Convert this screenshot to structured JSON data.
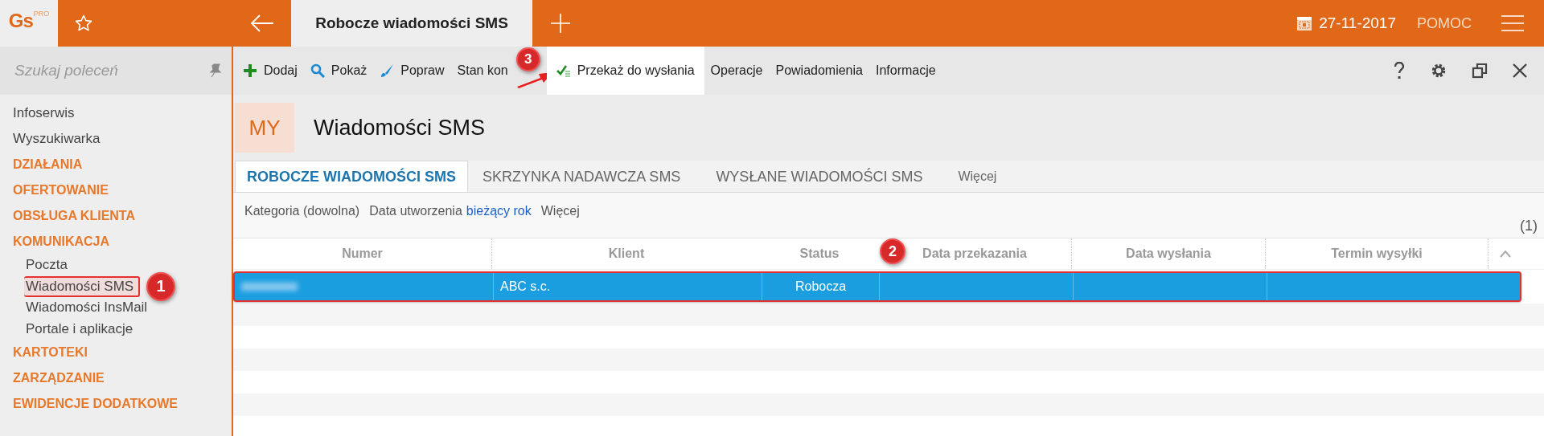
{
  "top_bar": {
    "logo": "Gs",
    "logo_badge": "PRO",
    "tab_title": "Robocze wiadomości SMS",
    "date": "27-11-2017",
    "help": "POMOC"
  },
  "sidebar": {
    "search": {
      "placeholder": "Szukaj poleceń"
    },
    "items": [
      {
        "label": "Infoserwis",
        "kind": "link"
      },
      {
        "label": "Wyszukiwarka",
        "kind": "link"
      },
      {
        "label": "DZIAŁANIA",
        "kind": "section"
      },
      {
        "label": "OFERTOWANIE",
        "kind": "section"
      },
      {
        "label": "OBSŁUGA KLIENTA",
        "kind": "section"
      },
      {
        "label": "KOMUNIKACJA",
        "kind": "section",
        "children": [
          {
            "label": "Poczta",
            "selected": false
          },
          {
            "label": "Wiadomości SMS",
            "selected": true,
            "callout": "1"
          },
          {
            "label": "Wiadomości InsMail",
            "selected": false
          },
          {
            "label": "Portale i aplikacje",
            "selected": false
          }
        ]
      },
      {
        "label": "KARTOTEKI",
        "kind": "section"
      },
      {
        "label": "ZARZĄDZANIE",
        "kind": "section"
      },
      {
        "label": "EWIDENCJE DODATKOWE",
        "kind": "section"
      }
    ]
  },
  "toolbar": {
    "items": [
      {
        "label": "Dodaj",
        "kind": "add",
        "selected": false
      },
      {
        "label": "Pokaż",
        "kind": "view",
        "selected": false
      },
      {
        "label": "Popraw",
        "kind": "edit",
        "selected": false
      },
      {
        "label": "Stan kon",
        "kind": "plain",
        "selected": false
      },
      {
        "label": "Przekaż do wysłania",
        "kind": "send",
        "selected": true,
        "callout": "3"
      },
      {
        "label": "Operacje",
        "kind": "plain",
        "selected": false
      },
      {
        "label": "Powiadomienia",
        "kind": "plain",
        "selected": false
      },
      {
        "label": "Informacje",
        "kind": "plain",
        "selected": false
      }
    ]
  },
  "page": {
    "badge": "MY",
    "title": "Wiadomości SMS"
  },
  "tabs": [
    {
      "label": "ROBOCZE WIADOMOŚCI SMS",
      "selected": true
    },
    {
      "label": "SKRZYNKA NADAWCZA SMS",
      "selected": false
    },
    {
      "label": "WYSŁANE WIADOMOŚCI SMS",
      "selected": false
    },
    {
      "label": "Więcej",
      "selected": false
    }
  ],
  "filters": [
    {
      "label": "Kategoria (dowolna)"
    },
    {
      "label": "Data utworzenia",
      "value": "bieżący rok"
    },
    {
      "label": "Więcej"
    }
  ],
  "count": "(1)",
  "table": {
    "columns": [
      {
        "label": "Numer"
      },
      {
        "label": "Klient"
      },
      {
        "label": "Status",
        "callout": "2"
      },
      {
        "label": "Data przekazania"
      },
      {
        "label": "Data wysłania"
      },
      {
        "label": "Termin wysyłki"
      }
    ],
    "rows": [
      {
        "number_redacted": true,
        "client": "ABC s.c.",
        "status": "Robocza",
        "selected": true
      }
    ]
  }
}
